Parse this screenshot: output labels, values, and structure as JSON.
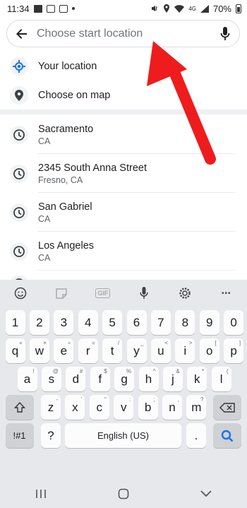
{
  "status_bar": {
    "time": "11:34",
    "battery": "70%",
    "network": "4G"
  },
  "search": {
    "placeholder": "Choose start location",
    "value": ""
  },
  "options": [
    {
      "label": "Your location",
      "icon": "my-location-icon",
      "accent": "#1a73e8"
    },
    {
      "label": "Choose on map",
      "icon": "map-pin-icon"
    }
  ],
  "recent": [
    {
      "title": "Sacramento",
      "subtitle": "CA"
    },
    {
      "title": "2345 South Anna Street",
      "subtitle": "Fresno, CA"
    },
    {
      "title": "San Gabriel",
      "subtitle": "CA"
    },
    {
      "title": "Los Angeles",
      "subtitle": "CA"
    }
  ],
  "annotation": {
    "color": "#ee1c1c"
  },
  "keyboard": {
    "toolbar": [
      "emoji-icon",
      "sticker-icon",
      "gif-icon",
      "mic-icon",
      "settings-icon",
      "more-icon"
    ],
    "toolbar_gif": "GIF",
    "toolbar_more": "•••",
    "row_numbers": [
      "1",
      "2",
      "3",
      "4",
      "5",
      "6",
      "7",
      "8",
      "9",
      "0"
    ],
    "row_top": [
      "q",
      "w",
      "e",
      "r",
      "t",
      "y",
      "u",
      "i",
      "o",
      "p"
    ],
    "row_top_hints": [
      "+",
      "×",
      "÷",
      "=",
      "/",
      "_",
      "<",
      ">",
      "[",
      "]"
    ],
    "row_mid": [
      "a",
      "s",
      "d",
      "f",
      "g",
      "h",
      "j",
      "k",
      "l"
    ],
    "row_mid_hints": [
      "!",
      "@",
      "#",
      "$",
      "%",
      "^",
      "&",
      "*",
      "(",
      ")"
    ],
    "row_bottom": [
      "z",
      "x",
      "c",
      "v",
      "b",
      "n",
      "m"
    ],
    "row_bottom_hints": [
      "-",
      "'",
      "\"",
      ":",
      ";",
      ",",
      "?"
    ],
    "symbols_key": "!#1",
    "question_key": "?",
    "space_label": "English (US)",
    "period_key": ".",
    "action_color": "#1a73e8"
  }
}
